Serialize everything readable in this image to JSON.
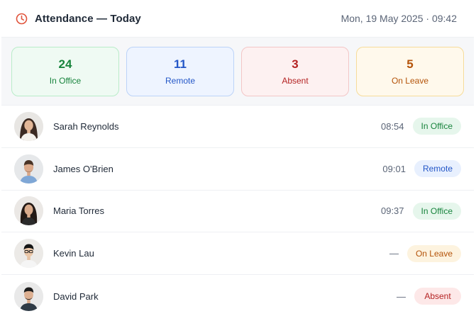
{
  "header": {
    "title": "Attendance — Today",
    "datetime": "Mon, 19 May 2025 · 09:42",
    "icon": "clock-icon",
    "accent": "#e0533b"
  },
  "stats": [
    {
      "value": "24",
      "label": "In Office",
      "tone": "green"
    },
    {
      "value": "11",
      "label": "Remote",
      "tone": "blue"
    },
    {
      "value": "3",
      "label": "Absent",
      "tone": "red"
    },
    {
      "value": "5",
      "label": "On Leave",
      "tone": "amber"
    }
  ],
  "people": [
    {
      "name": "Sarah Reynolds",
      "time": "08:54",
      "status": "In Office",
      "tone": "green"
    },
    {
      "name": "James O'Brien",
      "time": "09:01",
      "status": "Remote",
      "tone": "blue"
    },
    {
      "name": "Maria Torres",
      "time": "09:37",
      "status": "In Office",
      "tone": "green"
    },
    {
      "name": "Kevin Lau",
      "time": "—",
      "status": "On Leave",
      "tone": "amber"
    },
    {
      "name": "David Park",
      "time": "—",
      "status": "Absent",
      "tone": "red"
    }
  ],
  "colors": {
    "green": "#18843d",
    "blue": "#2356c7",
    "red": "#b42323",
    "amber": "#b45309"
  }
}
